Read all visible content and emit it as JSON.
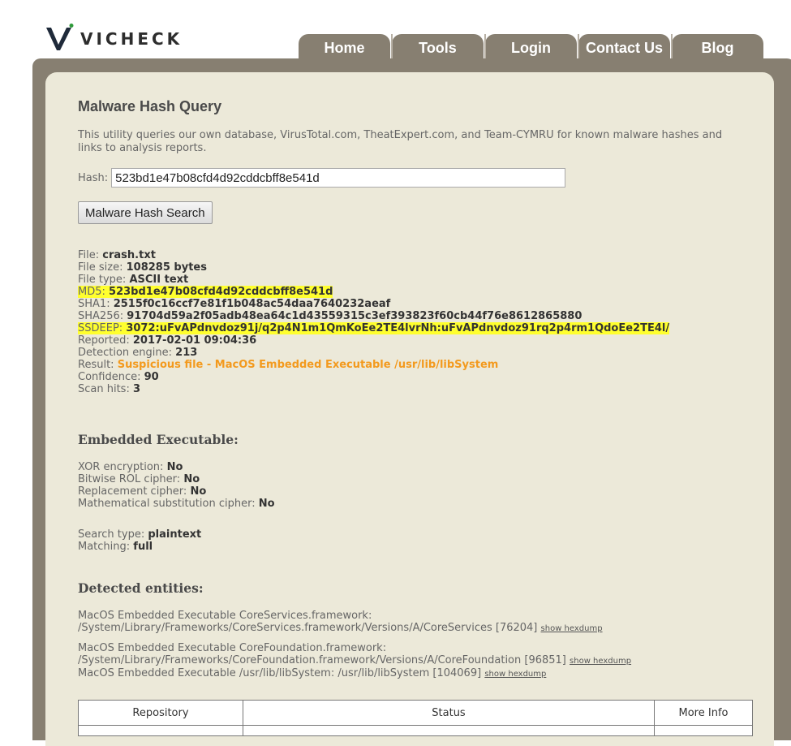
{
  "brand": {
    "logo_text": "VICHECK",
    "accent": "#877f71",
    "panel_bg": "#ece9d9",
    "highlight": "#ffff2e",
    "result_color": "#f39a1e"
  },
  "nav": {
    "tabs": [
      "Home",
      "Tools",
      "Login",
      "Contact Us",
      "Blog"
    ]
  },
  "page": {
    "title": "Malware Hash Query",
    "intro": "This utility queries our own database, VirusTotal.com, TheatExpert.com, and Team-CYMRU for known malware hashes and links to analysis reports."
  },
  "search": {
    "hash_label": "Hash:",
    "hash_value": "523bd1e47b08cfd4d92cddcbff8e541d",
    "button_label": "Malware Hash Search"
  },
  "file": {
    "file_label": "File:",
    "file_name": "crash.txt",
    "size_label": "File size:",
    "size": "108285 bytes",
    "type_label": "File type:",
    "type": "ASCII text",
    "md5_label": "MD5:",
    "md5": "523bd1e47b08cfd4d92cddcbff8e541d",
    "sha1_label": "SHA1:",
    "sha1": "2515f0c16ccf7e81f1b048ac54daa7640232aeaf",
    "sha256_label": "SHA256:",
    "sha256": "91704d59a2f05adb48ea64c1d43559315c3ef393823f60cb44f76e8612865880",
    "ssdeep_label": "SSDEEP:",
    "ssdeep": "3072:uFvAPdnvdoz91j/q2p4N1m1QmKoEe2TE4lvrNh:uFvAPdnvdoz91rq2p4rm1QdoEe2TE4l/",
    "reported_label": "Reported:",
    "reported": "2017-02-01 09:04:36",
    "engine_label": "Detection engine:",
    "engine": "213",
    "result_label": "Result:",
    "result": "Suspicious file - MacOS Embedded Executable /usr/lib/libSystem",
    "confidence_label": "Confidence:",
    "confidence": "90",
    "hits_label": "Scan hits:",
    "hits": "3"
  },
  "embedded": {
    "heading": "Embedded Executable:",
    "xor_label": "XOR encryption:",
    "xor": "No",
    "rol_label": "Bitwise ROL cipher:",
    "rol": "No",
    "repl_label": "Replacement cipher:",
    "repl": "No",
    "math_label": "Mathematical substitution cipher:",
    "math": "No",
    "stype_label": "Search type:",
    "stype": "plaintext",
    "match_label": "Matching:",
    "match": "full"
  },
  "detected": {
    "heading": "Detected entities:",
    "e1_line1": "MacOS Embedded Executable CoreServices.framework:",
    "e1_line2": "/System/Library/Frameworks/CoreServices.framework/Versions/A/CoreServices [76204]",
    "e2_line1": "MacOS Embedded Executable CoreFoundation.framework:",
    "e2_line2": "/System/Library/Frameworks/CoreFoundation.framework/Versions/A/CoreFoundation [96851]",
    "e3_line1": "MacOS Embedded Executable /usr/lib/libSystem: /usr/lib/libSystem [104069]",
    "hexdump_link": "show hexdump"
  },
  "table": {
    "col_repository": "Repository",
    "col_status": "Status",
    "col_more": "More Info"
  }
}
